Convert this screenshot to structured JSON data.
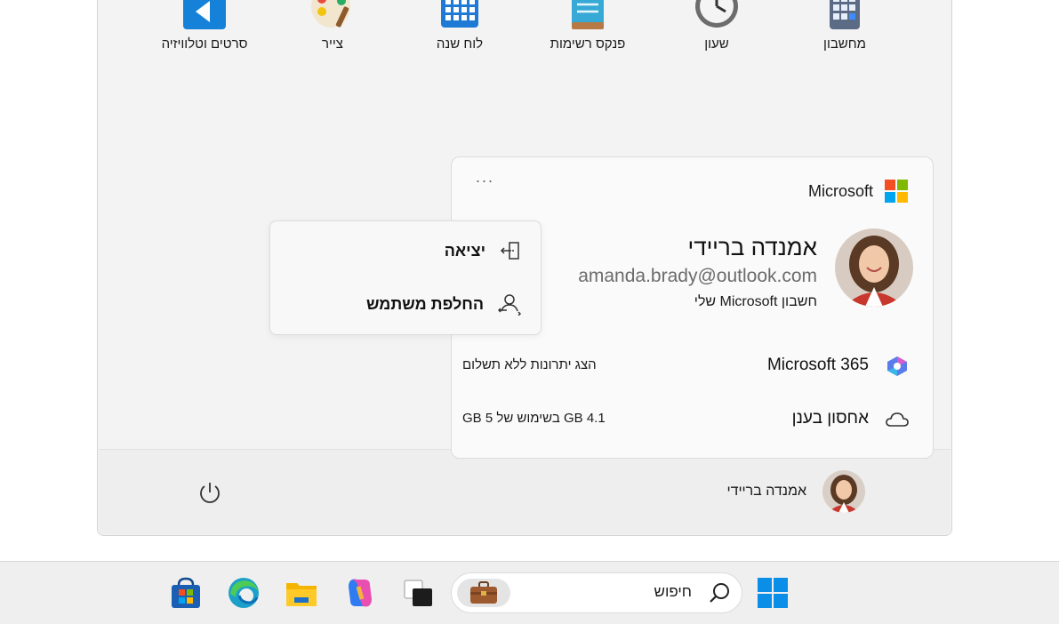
{
  "pinned_apps": [
    {
      "label": "מחשבון",
      "icon": "calculator-icon"
    },
    {
      "label": "שעון",
      "icon": "clock-icon"
    },
    {
      "label": "פנקס רשימות",
      "icon": "notepad-icon"
    },
    {
      "label": "לוח שנה",
      "icon": "calendar-icon"
    },
    {
      "label": "צייר",
      "icon": "paint-icon"
    },
    {
      "label": "סרטים וטלוויזיה",
      "icon": "movies-tv-icon"
    }
  ],
  "account_card": {
    "brand": "Microsoft",
    "more_label": "···",
    "user_name": "אמנדה ברײדי",
    "email": "amanda.brady@outlook.com",
    "account_link": "חשבון Microsoft שלי",
    "services": [
      {
        "name": "Microsoft 365",
        "detail": "הצג יתרונות ללא תשלום",
        "icon": "m365-icon"
      },
      {
        "name": "אחסון בענן",
        "detail": "4.1 GB בשימוש של 5 GB",
        "icon": "cloud-icon"
      }
    ]
  },
  "flyout": {
    "sign_out": "יציאה",
    "switch_user": "החלפת משתמש"
  },
  "footer": {
    "user_name": "אמנדה ברײדי"
  },
  "taskbar": {
    "search_placeholder": "חיפוש"
  },
  "colors": {
    "accent_blue": "#0a6cd6",
    "ms_red": "#f25022",
    "ms_green": "#7fba00",
    "ms_blue": "#00a4ef",
    "ms_yellow": "#ffb900"
  }
}
